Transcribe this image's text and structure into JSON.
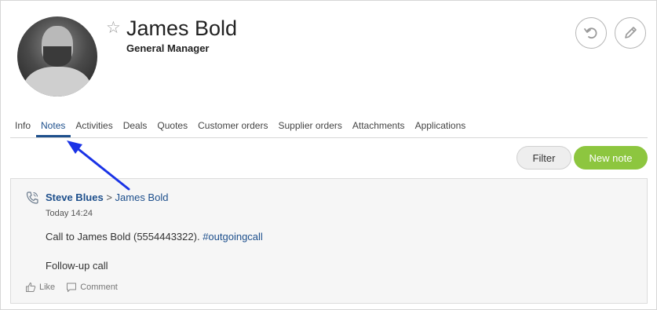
{
  "profile": {
    "name": "James Bold",
    "role": "General Manager"
  },
  "header_icons": [
    "star-icon",
    "undo-icon",
    "pencil-icon"
  ],
  "tabs": [
    {
      "label": "Info"
    },
    {
      "label": "Notes",
      "active": true
    },
    {
      "label": "Activities"
    },
    {
      "label": "Deals"
    },
    {
      "label": "Quotes"
    },
    {
      "label": "Customer orders"
    },
    {
      "label": "Supplier orders"
    },
    {
      "label": "Attachments"
    },
    {
      "label": "Applications"
    }
  ],
  "toolbar": {
    "filter_label": "Filter",
    "new_note_label": "New note"
  },
  "note": {
    "author": "Steve Blues",
    "separator": " > ",
    "target": "James Bold",
    "time": "Today 14:24",
    "body_text": "Call to James Bold (5554443322). ",
    "hashtag": "#outgoingcall",
    "body_line2": "Follow-up call",
    "like_label": "Like",
    "comment_label": "Comment"
  },
  "colors": {
    "accent_blue": "#1d4f8c",
    "new_note_green": "#8dc63f",
    "annotation_arrow": "#1a33e6"
  }
}
